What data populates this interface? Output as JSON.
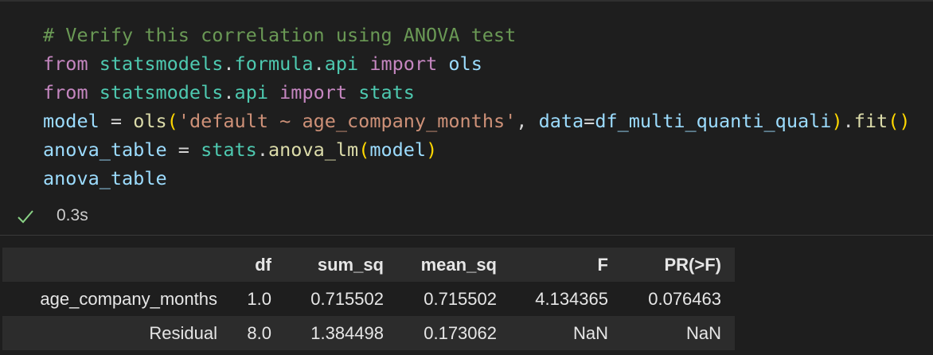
{
  "code": {
    "lines": [
      [
        {
          "t": "# Verify this correlation using ANOVA test",
          "c": "comment"
        }
      ],
      [
        {
          "t": "from",
          "c": "keyword"
        },
        {
          "t": " ",
          "c": "op"
        },
        {
          "t": "statsmodels",
          "c": "module"
        },
        {
          "t": ".",
          "c": "op"
        },
        {
          "t": "formula",
          "c": "module"
        },
        {
          "t": ".",
          "c": "op"
        },
        {
          "t": "api",
          "c": "module"
        },
        {
          "t": " ",
          "c": "op"
        },
        {
          "t": "import",
          "c": "keyword"
        },
        {
          "t": " ",
          "c": "op"
        },
        {
          "t": "ols",
          "c": "var"
        }
      ],
      [
        {
          "t": "from",
          "c": "keyword"
        },
        {
          "t": " ",
          "c": "op"
        },
        {
          "t": "statsmodels",
          "c": "module"
        },
        {
          "t": ".",
          "c": "op"
        },
        {
          "t": "api",
          "c": "module"
        },
        {
          "t": " ",
          "c": "op"
        },
        {
          "t": "import",
          "c": "keyword"
        },
        {
          "t": " ",
          "c": "op"
        },
        {
          "t": "stats",
          "c": "module"
        }
      ],
      [
        {
          "t": "model",
          "c": "var"
        },
        {
          "t": " = ",
          "c": "op"
        },
        {
          "t": "ols",
          "c": "func"
        },
        {
          "t": "(",
          "c": "paren1"
        },
        {
          "t": "'default ~ age_company_months'",
          "c": "string"
        },
        {
          "t": ", ",
          "c": "op"
        },
        {
          "t": "data",
          "c": "var"
        },
        {
          "t": "=",
          "c": "op"
        },
        {
          "t": "df_multi_quanti_quali",
          "c": "var"
        },
        {
          "t": ")",
          "c": "paren1"
        },
        {
          "t": ".",
          "c": "op"
        },
        {
          "t": "fit",
          "c": "func"
        },
        {
          "t": "(",
          "c": "paren1"
        },
        {
          "t": ")",
          "c": "paren1"
        }
      ],
      [
        {
          "t": "anova_table",
          "c": "var"
        },
        {
          "t": " = ",
          "c": "op"
        },
        {
          "t": "stats",
          "c": "module"
        },
        {
          "t": ".",
          "c": "op"
        },
        {
          "t": "anova_lm",
          "c": "func"
        },
        {
          "t": "(",
          "c": "paren1"
        },
        {
          "t": "model",
          "c": "var"
        },
        {
          "t": ")",
          "c": "paren1"
        }
      ],
      [
        {
          "t": "anova_table",
          "c": "var"
        }
      ]
    ]
  },
  "status": {
    "icon": "check-icon",
    "time": "0.3s",
    "color": "#89d185"
  },
  "table": {
    "columns": [
      "",
      "df",
      "sum_sq",
      "mean_sq",
      "F",
      "PR(>F)"
    ],
    "rows": [
      [
        "age_company_months",
        "1.0",
        "0.715502",
        "0.715502",
        "4.134365",
        "0.076463"
      ],
      [
        "Residual",
        "8.0",
        "1.384498",
        "0.173062",
        "NaN",
        "NaN"
      ]
    ]
  }
}
